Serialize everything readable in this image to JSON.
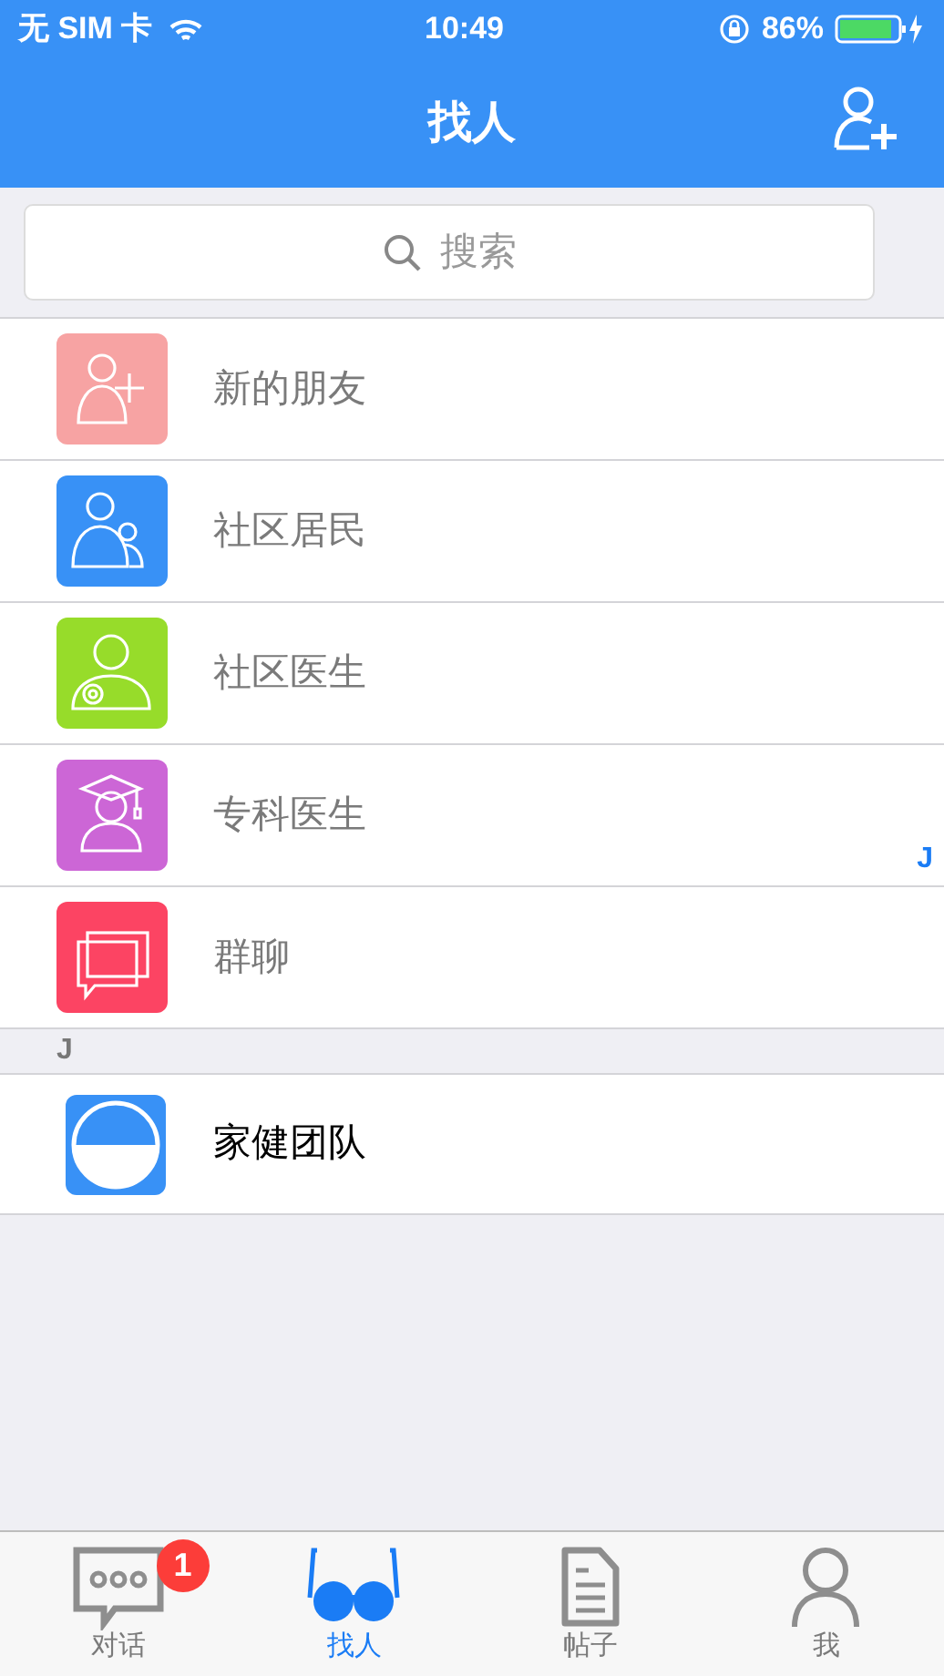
{
  "status_bar": {
    "carrier": "无 SIM 卡",
    "time": "10:49",
    "battery": "86%"
  },
  "nav": {
    "title": "找人"
  },
  "search": {
    "placeholder": "搜索"
  },
  "entries": [
    {
      "kind": "add-friend",
      "label": "新的朋友",
      "color": "#f7a3a3"
    },
    {
      "kind": "residents",
      "label": "社区居民",
      "color": "#3891f6"
    },
    {
      "kind": "doctor",
      "label": "社区医生",
      "color": "#97dc2a"
    },
    {
      "kind": "specialist",
      "label": "专科医生",
      "color": "#cc66d6"
    },
    {
      "kind": "group",
      "label": "群聊",
      "color": "#fc4463"
    }
  ],
  "sections": [
    {
      "header": "J",
      "contacts": [
        {
          "label": "家健团队"
        }
      ]
    }
  ],
  "index_bar": [
    "J"
  ],
  "tabs": [
    {
      "kind": "chat",
      "label": "对话",
      "selected": false,
      "badge": "1"
    },
    {
      "kind": "glasses",
      "label": "找人",
      "selected": true
    },
    {
      "kind": "document",
      "label": "帖子",
      "selected": false
    },
    {
      "kind": "person",
      "label": "我",
      "selected": false
    }
  ]
}
